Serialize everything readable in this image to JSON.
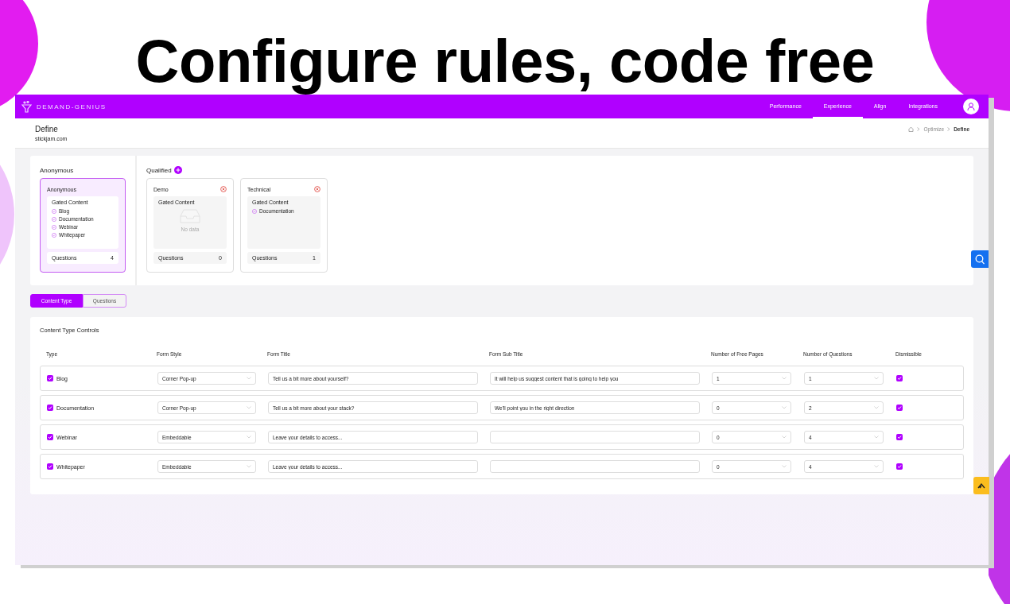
{
  "headline": "Configure rules, code free",
  "app": {
    "brand": "DEMAND-GENIUS",
    "nav": [
      {
        "label": "Performance",
        "selected": false
      },
      {
        "label": "Experience",
        "selected": true
      },
      {
        "label": "Align",
        "selected": false
      },
      {
        "label": "Integrations",
        "selected": false
      }
    ],
    "page_title": "Define",
    "site": "stickjam.com",
    "breadcrumb": [
      {
        "label": "Optimize",
        "current": false
      },
      {
        "label": "Define",
        "current": true
      }
    ],
    "anonymous": {
      "heading": "Anonymous",
      "cards": [
        {
          "title": "Anonymous",
          "selected": true,
          "deletable": false,
          "gated_title": "Gated Content",
          "items": [
            "Blog",
            "Documentation",
            "Webinar",
            "Whitepaper"
          ],
          "questions_label": "Questions",
          "questions_count": "4"
        }
      ]
    },
    "qualified": {
      "heading": "Qualified",
      "cards": [
        {
          "title": "Demo",
          "selected": false,
          "deletable": true,
          "gated_title": "Gated Content",
          "empty_text": "No data",
          "questions_label": "Questions",
          "questions_count": "0"
        },
        {
          "title": "Technical",
          "selected": false,
          "deletable": true,
          "gated_title": "Gated Content",
          "items": [
            "Documentation"
          ],
          "questions_label": "Questions",
          "questions_count": "1"
        }
      ]
    },
    "tabs": [
      {
        "label": "Content Type",
        "selected": true
      },
      {
        "label": "Questions",
        "selected": false
      }
    ],
    "table": {
      "title": "Content Type Controls",
      "columns": [
        "Type",
        "Form Style",
        "Form Title",
        "Form Sub Title",
        "Number of Free Pages",
        "Number of Questions",
        "Dismissible"
      ],
      "rows": [
        {
          "type": "Blog",
          "checked": true,
          "form_style": "Corner Pop-up",
          "form_title": "Tell us a bit more about yourself?",
          "form_sub_title": "It will help us suggest content that is going to help you",
          "free_pages": "1",
          "questions": "1",
          "dismissible": true
        },
        {
          "type": "Documentation",
          "checked": true,
          "form_style": "Corner Pop-up",
          "form_title": "Tell us a bit more about your stack?",
          "form_sub_title": "We'll point you in the right direction",
          "free_pages": "0",
          "questions": "2",
          "dismissible": true
        },
        {
          "type": "Webinar",
          "checked": true,
          "form_style": "Embeddable",
          "form_title": "Leave your details to access...",
          "free_pages": "0",
          "questions": "4",
          "dismissible": true
        },
        {
          "type": "Whitepaper",
          "checked": true,
          "form_style": "Embeddable",
          "form_title": "Leave your details to access...",
          "free_pages": "0",
          "questions": "4",
          "dismissible": true
        }
      ]
    }
  }
}
